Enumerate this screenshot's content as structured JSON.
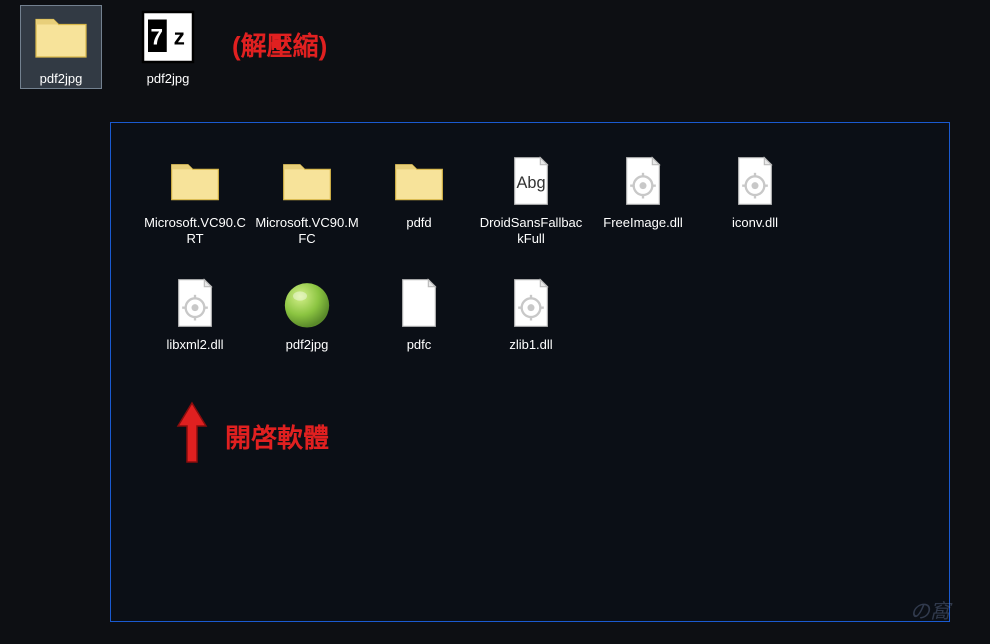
{
  "desktop": {
    "items": [
      {
        "label": "pdf2jpg",
        "type": "folder",
        "selected": true
      },
      {
        "label": "pdf2jpg",
        "type": "7z",
        "selected": false
      }
    ]
  },
  "annotations": {
    "extract": "(解壓縮)",
    "open": "開啓軟體"
  },
  "folder_contents": {
    "items": [
      {
        "label": "Microsoft.VC90.CRT",
        "type": "folder"
      },
      {
        "label": "Microsoft.VC90.MFC",
        "type": "folder"
      },
      {
        "label": "pdfd",
        "type": "folder"
      },
      {
        "label": "DroidSansFallbackFull",
        "type": "font"
      },
      {
        "label": "FreeImage.dll",
        "type": "dll"
      },
      {
        "label": "iconv.dll",
        "type": "dll"
      },
      {
        "label": "libxml2.dll",
        "type": "dll"
      },
      {
        "label": "pdf2jpg",
        "type": "app"
      },
      {
        "label": "pdfc",
        "type": "file"
      },
      {
        "label": "zlib1.dll",
        "type": "dll"
      }
    ]
  },
  "watermark": "の窩"
}
